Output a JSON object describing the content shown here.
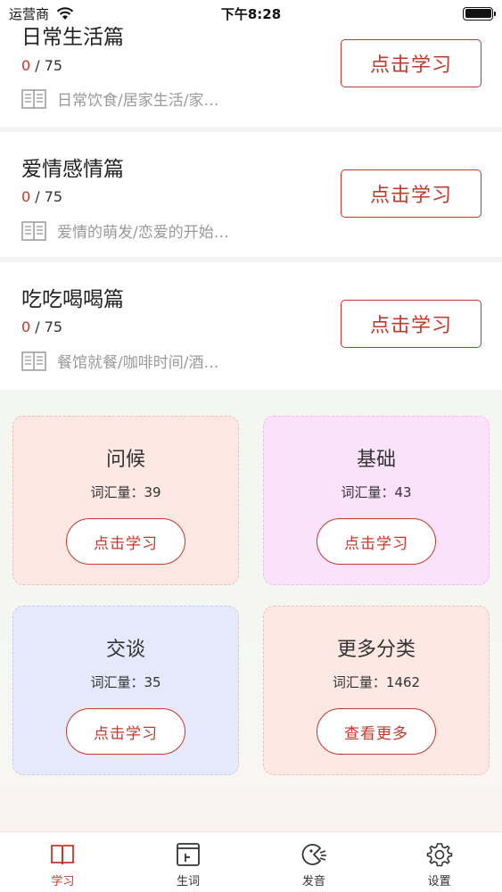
{
  "status_bar": {
    "carrier": "运营商",
    "time": "下午8:28"
  },
  "courses": [
    {
      "title": "日常生活篇",
      "done": "0",
      "total": " / 75",
      "description": "日常饮食/居家生活/家…",
      "button": "点击学习"
    },
    {
      "title": "爱情感情篇",
      "done": "0",
      "total": " / 75",
      "description": "爱情的萌发/恋爱的开始…",
      "button": "点击学习"
    },
    {
      "title": "吃吃喝喝篇",
      "done": "0",
      "total": " / 75",
      "description": "餐馆就餐/咖啡时间/酒…",
      "button": "点击学习"
    }
  ],
  "categories": [
    {
      "title": "问候",
      "count": "词汇量：39",
      "button": "点击学习",
      "color": "#fde7e3"
    },
    {
      "title": "基础",
      "count": "词汇量：43",
      "button": "点击学习",
      "color": "#fbe2fb"
    },
    {
      "title": "交谈",
      "count": "词汇量：35",
      "button": "点击学习",
      "color": "#e5e9fb"
    },
    {
      "title": "更多分类",
      "count": "词汇量：1462",
      "button": "查看更多",
      "color": "#fde8e3"
    }
  ],
  "tabs": [
    {
      "label": "学习",
      "icon": "book-icon",
      "active": true
    },
    {
      "label": "生词",
      "icon": "vocab-icon",
      "active": false
    },
    {
      "label": "发音",
      "icon": "pronunciation-icon",
      "active": false
    },
    {
      "label": "设置",
      "icon": "gear-icon",
      "active": false
    }
  ],
  "accent_color": "#c0392b"
}
